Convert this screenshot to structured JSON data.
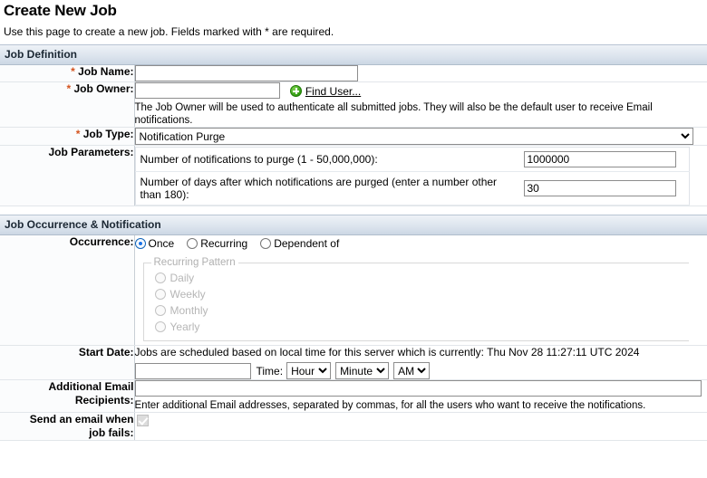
{
  "page": {
    "title": "Create New Job",
    "intro": "Use this page to create a new job. Fields marked with * are required."
  },
  "sections": {
    "job_definition": "Job Definition",
    "job_occurrence": "Job Occurrence & Notification"
  },
  "job_definition": {
    "job_name": {
      "label": "Job Name:",
      "required_marker": "*",
      "value": ""
    },
    "job_owner": {
      "label": "Job Owner:",
      "required_marker": "*",
      "value": "",
      "find_user_link": "Find User...",
      "find_user_icon": "green-plus-icon",
      "help": "The Job Owner will be used to authenticate all submitted jobs. They will also be the default user to receive Email notifications."
    },
    "job_type": {
      "label": "Job Type:",
      "required_marker": "*",
      "selected": "Notification Purge"
    },
    "job_parameters": {
      "label": "Job Parameters:",
      "rows": [
        {
          "name": "Number of notifications to purge (1 - 50,000,000):",
          "value": "1000000"
        },
        {
          "name": "Number of days after which notifications are purged (enter a number other than 180):",
          "value": "30"
        }
      ]
    }
  },
  "job_occurrence": {
    "occurrence": {
      "label": "Occurrence:",
      "options": [
        {
          "label": "Once",
          "selected": true
        },
        {
          "label": "Recurring",
          "selected": false
        },
        {
          "label": "Dependent of",
          "selected": false
        }
      ]
    },
    "recurring_pattern": {
      "legend": "Recurring Pattern",
      "disabled": true,
      "options": [
        {
          "label": "Daily"
        },
        {
          "label": "Weekly"
        },
        {
          "label": "Monthly"
        },
        {
          "label": "Yearly"
        }
      ]
    },
    "start_date": {
      "label": "Start Date:",
      "note": "Jobs are scheduled based on local time for this server which is currently: Thu Nov 28 11:27:11 UTC 2024",
      "value": "",
      "time_label": "Time:",
      "hour": "Hour",
      "minute": "Minute",
      "meridiem": "AM"
    },
    "additional_email": {
      "label_line1": "Additional Email",
      "label_line2": "Recipients:",
      "value": "",
      "help": "Enter additional Email addresses, separated by commas, for all the users who want to receive the notifications."
    },
    "send_email_on_fail": {
      "label_line1": "Send an email when",
      "label_line2": "job fails:",
      "checked": true,
      "disabled": true
    }
  }
}
